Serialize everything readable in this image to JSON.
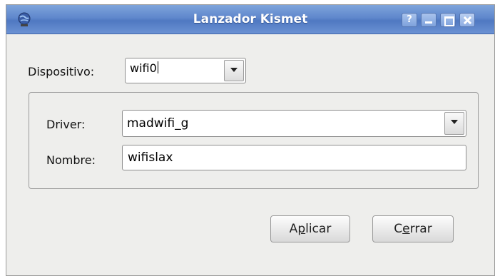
{
  "window": {
    "title": "Lanzador Kismet",
    "help_label": "?",
    "icon": "kismet-globe-icon"
  },
  "form": {
    "dispositivo_label": "Dispositivo:",
    "dispositivo_value": "wifi0",
    "driver_label": "Driver:",
    "driver_value": "madwifi_g",
    "nombre_label": "Nombre:",
    "nombre_value": "wifislax"
  },
  "buttons": {
    "apply_pre": "A",
    "apply_mnemonic": "p",
    "apply_post": "licar",
    "close_pre": "C",
    "close_mnemonic": "e",
    "close_post": "rrar"
  },
  "colors": {
    "titlebar": "#5f87cc",
    "window_bg": "#eeeeec"
  }
}
